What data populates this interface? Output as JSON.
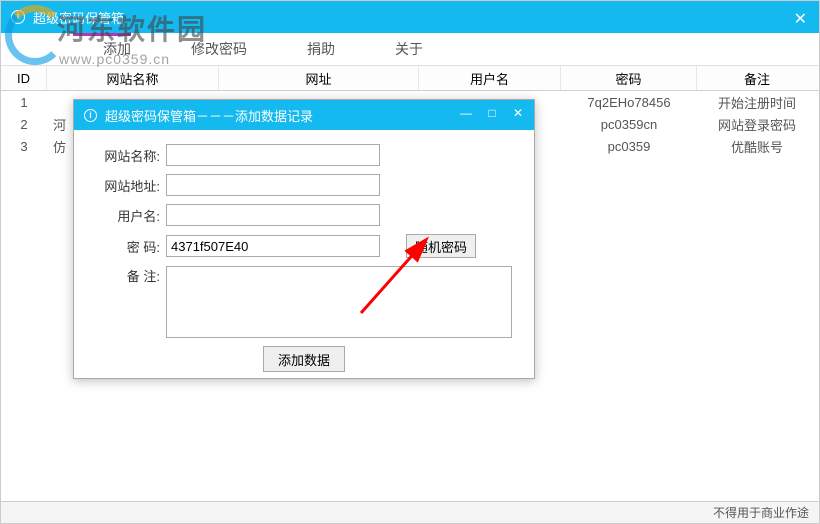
{
  "main_window": {
    "title": "超级密码保管箱"
  },
  "watermark": {
    "text": "河东软件园",
    "url": "www.pc0359.cn"
  },
  "menu": {
    "items": [
      "添加",
      "修改密码",
      "捐助",
      "关于"
    ]
  },
  "table": {
    "headers": {
      "id": "ID",
      "name": "网站名称",
      "url": "网址",
      "user": "用户名",
      "pass": "密码",
      "note": "备注"
    },
    "rows": [
      {
        "id": "1",
        "name": "",
        "url": "",
        "user": "",
        "pass": "7q2EHo78456",
        "note": "开始注册时间"
      },
      {
        "id": "2",
        "name": "河",
        "url": "",
        "user": "",
        "pass": "pc0359cn",
        "note": "网站登录密码"
      },
      {
        "id": "3",
        "name": "仿",
        "url": "",
        "user": "",
        "pass": "pc0359",
        "note": "优酷账号"
      }
    ]
  },
  "dialog": {
    "title": "超级密码保管箱－－－添加数据记录",
    "labels": {
      "site_name": "网站名称:",
      "site_url": "网站地址:",
      "username": "用户名:",
      "password": "密  码:",
      "note": "备  注:"
    },
    "values": {
      "site_name": "",
      "site_url": "",
      "username": "",
      "password": "4371f507E40",
      "note": ""
    },
    "buttons": {
      "random": "随机密码",
      "add": "添加数据"
    }
  },
  "footer": {
    "text": "不得用于商业作途"
  }
}
